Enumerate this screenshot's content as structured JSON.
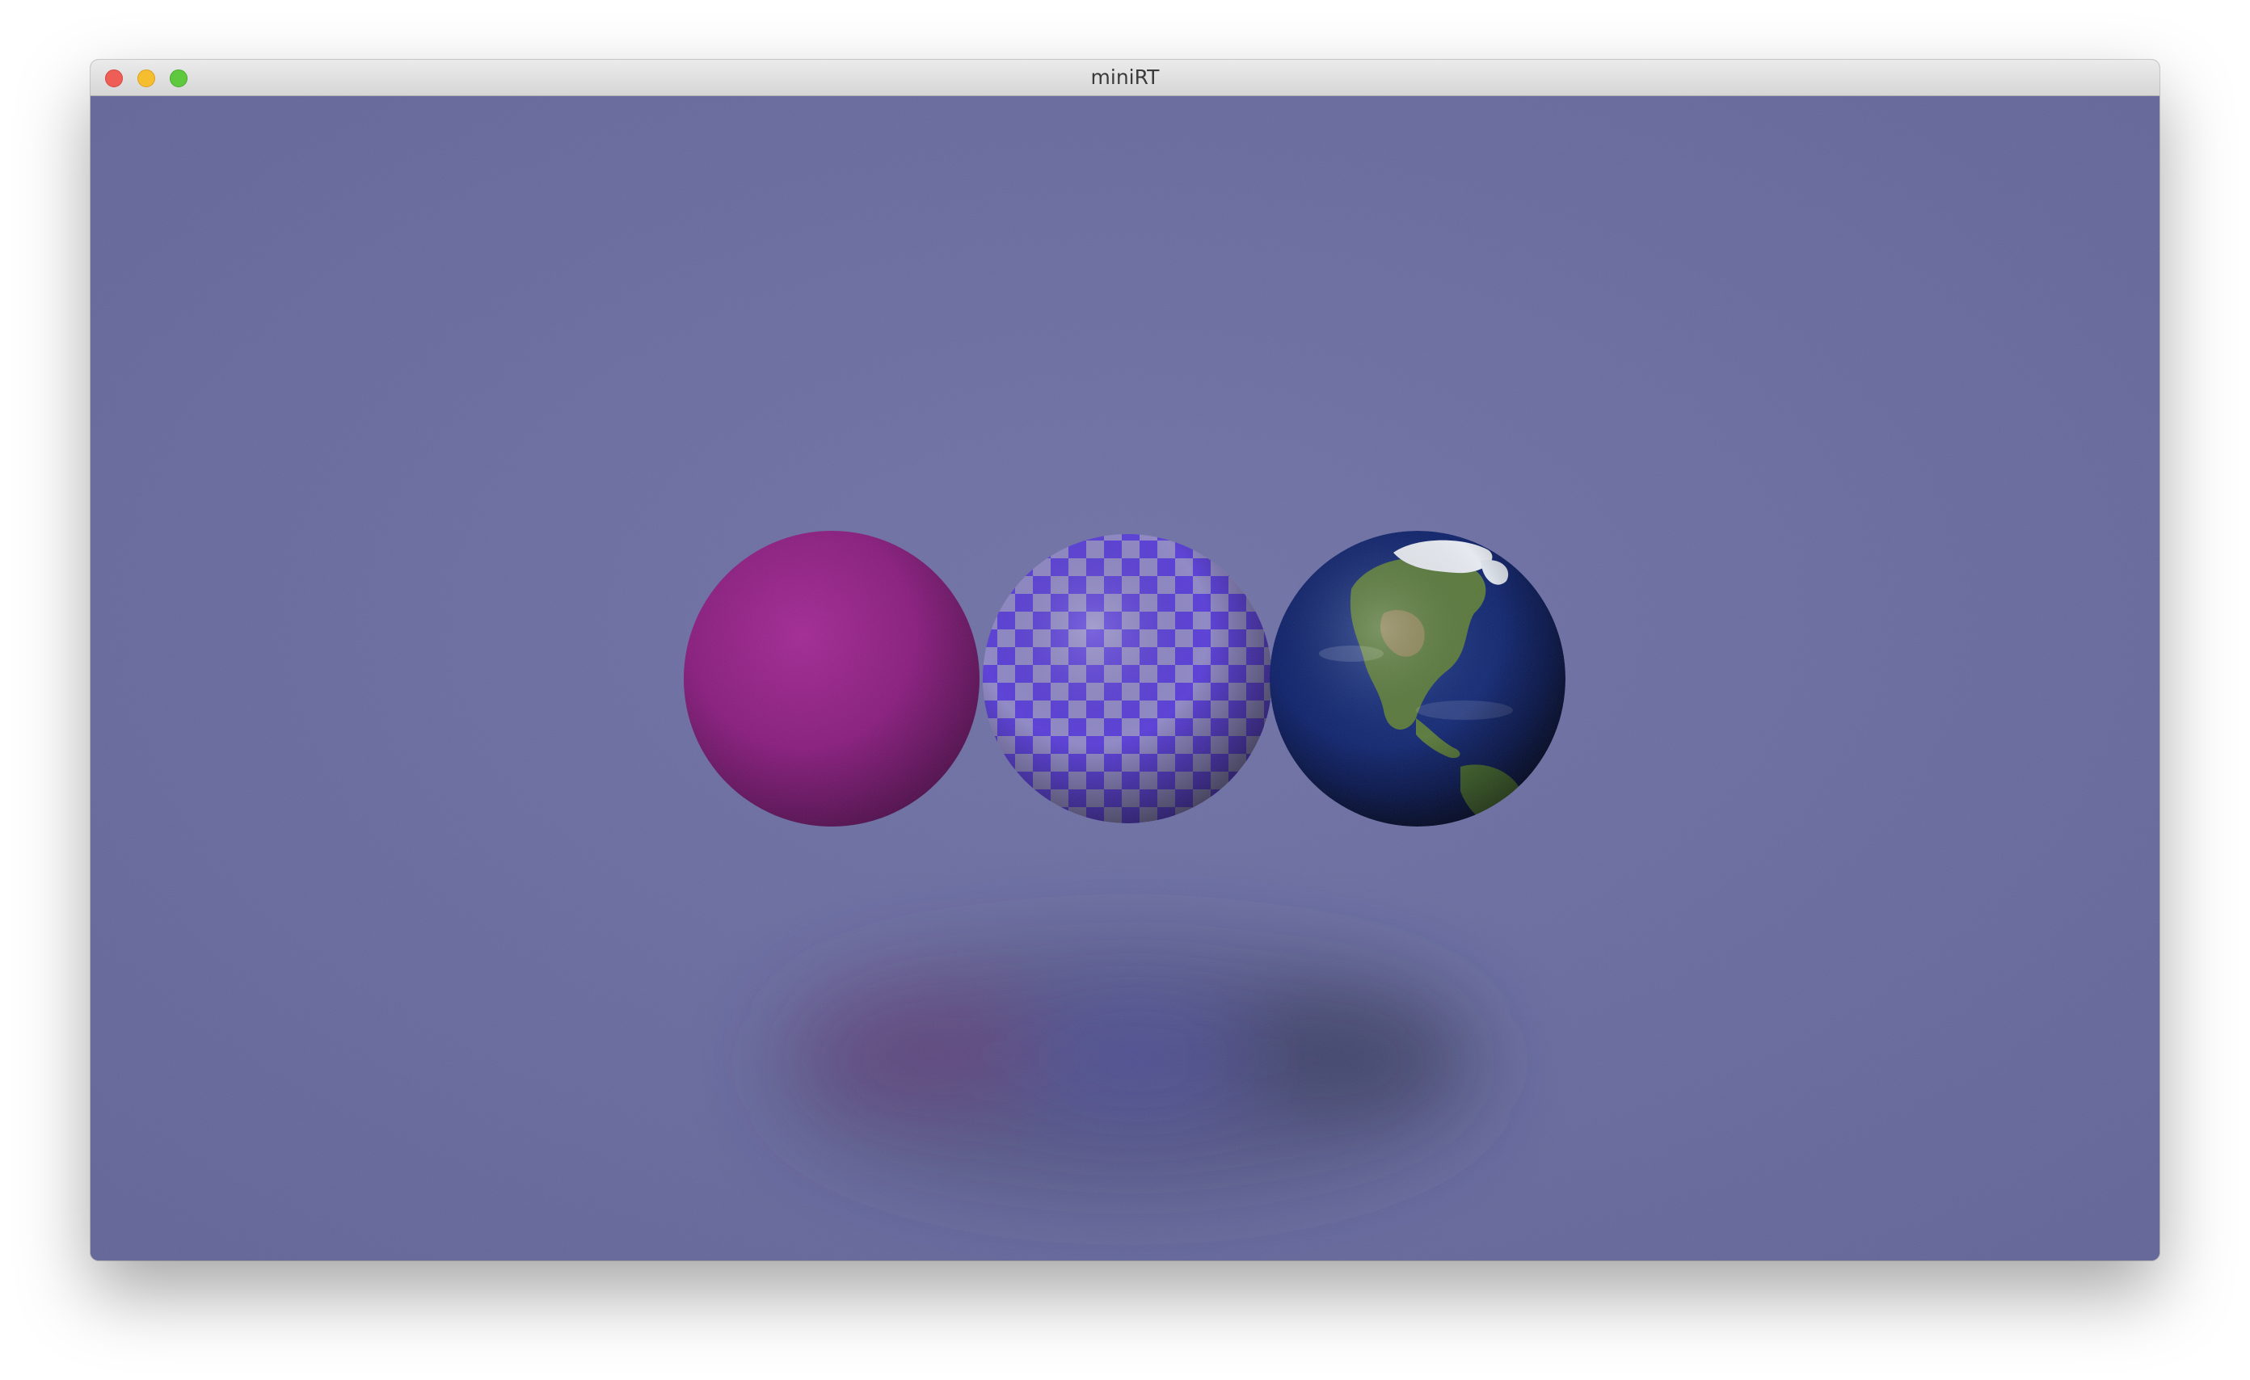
{
  "window": {
    "title": "miniRT"
  },
  "scene": {
    "background_color": "#6c6fa0",
    "objects": [
      {
        "name": "solid-sphere",
        "material": "solid",
        "color": "#8c1d7f"
      },
      {
        "name": "checker-sphere",
        "material": "checkerboard",
        "color_a": "#5a3ed8",
        "color_b": "#8f88c6"
      },
      {
        "name": "earth-sphere",
        "material": "earth-texture",
        "ocean_color": "#0d1f66",
        "land_color": "#5b7b3d"
      }
    ]
  },
  "icons": {
    "close": "close-button",
    "minimize": "minimize-button",
    "zoom": "zoom-button"
  }
}
